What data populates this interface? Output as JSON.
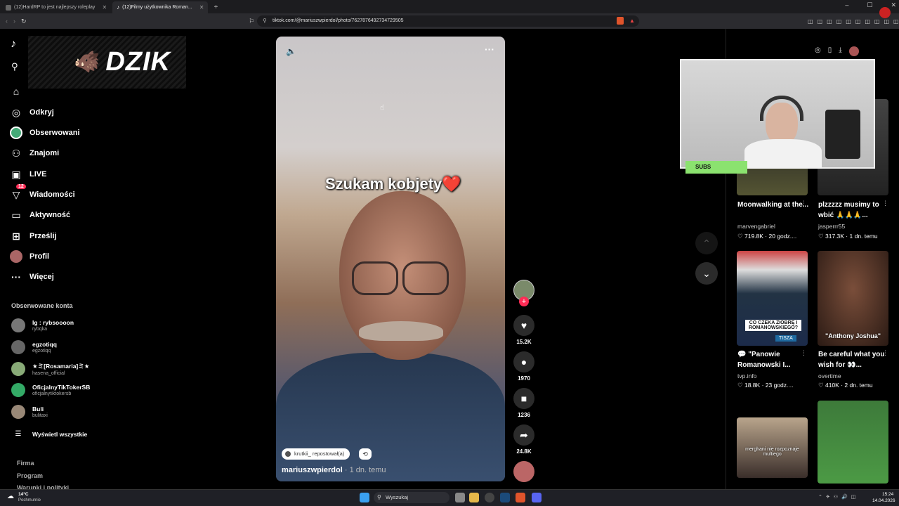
{
  "tabs": [
    {
      "label": "(12)HardRP to jest najlepszy roleplay"
    },
    {
      "label": "(12)Filmy użytkownika Roman..."
    }
  ],
  "window_controls": {
    "minimize": "–",
    "maximize": "☐",
    "close": "✕"
  },
  "address": {
    "url": "tiktok.com/@mariuszwpierdol/photo/7627876492734729505"
  },
  "overlay_logo": "DZIK",
  "sidebar": {
    "items": [
      {
        "label": "",
        "icon": "home-icon"
      },
      {
        "label": "Odkryj",
        "icon": "compass-icon"
      },
      {
        "label": "Obserwowani",
        "icon": "avatar"
      },
      {
        "label": "Znajomi",
        "icon": "friends-icon"
      },
      {
        "label": "LIVE",
        "icon": "live-icon"
      },
      {
        "label": "Wiadomości",
        "icon": "send-icon",
        "badge": "12"
      },
      {
        "label": "Aktywność",
        "icon": "activity-icon"
      },
      {
        "label": "Prześlij",
        "icon": "upload-icon"
      },
      {
        "label": "Profil",
        "icon": "avatar"
      },
      {
        "label": "Więcej",
        "icon": "more-icon"
      }
    ],
    "followed_heading": "Obserwowane konta",
    "followed": [
      {
        "name": "Ig : rybsoooon",
        "handle": "rybqka"
      },
      {
        "name": "egzotiqq",
        "handle": "egzotiqq"
      },
      {
        "name": "★ミ[Rosamaria]ミ★",
        "handle": "hasena_official"
      },
      {
        "name": "OficjalnyTikTokerSB",
        "handle": "oficjalnytiktokersb"
      },
      {
        "name": "Buli",
        "handle": "bulitaxi"
      }
    ],
    "show_all": "Wyświetl wszystkie",
    "footer": [
      "Firma",
      "Program",
      "Warunki i polityki"
    ]
  },
  "video": {
    "caption": "Szukam kobjety❤️",
    "repost_label": "krutkii_ repostował(a)",
    "author": "mariuszwpierdol",
    "time": " · 1 dn. temu"
  },
  "actions": {
    "likes": "15.2K",
    "comments": "1970",
    "saves": "1236",
    "shares": "24.8K"
  },
  "right_panel": {
    "cards": [
      {
        "title": "Moonwalking at the...",
        "author": "marvengabriel",
        "views": "719.8K",
        "time": "20 godz...."
      },
      {
        "title": "plzzzzz musimy to wbić 🙏🙏🙏...",
        "author": "jasperrr55",
        "views": "317.3K",
        "time": "1 dn. temu"
      },
      {
        "title": "💬 \"Panowie Romanowski I...",
        "author": "tvp.info",
        "views": "18.8K",
        "time": "23 godz....",
        "overlay": "CO CZEKA ZIOBRĘ I ROMANOWSKIEGO?",
        "tag": "TISZA"
      },
      {
        "title": "Be careful what you wish for 👀...",
        "author": "overtime",
        "views": "410K",
        "time": "2 dn. temu",
        "overlay": "\"Anthony Joshua\""
      },
      {
        "overlay": "merghani nie rozpoznaje multiego"
      }
    ]
  },
  "webcam": {
    "subs_label": "SUBS"
  },
  "taskbar": {
    "weather_temp": "14°C",
    "weather_desc": "Pochmurnie",
    "search_placeholder": "Wyszukaj",
    "time": "15:24",
    "date": "14.04.2026"
  }
}
